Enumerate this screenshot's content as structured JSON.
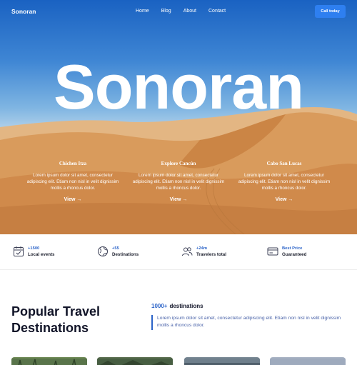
{
  "nav": {
    "brand": "Sonoran",
    "links": [
      "Home",
      "Blog",
      "About",
      "Contact"
    ],
    "cta": "Call today"
  },
  "hero": {
    "title": "Sonoran",
    "features": [
      {
        "title": "Chichen Itza",
        "desc": "Lorem ipsum dolor sit amet, consectetur adipiscing elit. Etiam non nisl in velit dignissim mollis a rhoncus dolor.",
        "link": "View →"
      },
      {
        "title": "Explore Cancún",
        "desc": "Lorem ipsum dolor sit amet, consectetur adipiscing elit. Etiam non nisl in velit dignissim mollis a rhoncus dolor.",
        "link": "View →"
      },
      {
        "title": "Cabo San Lucas",
        "desc": "Lorem ipsum dolor sit amet, consectetur adipiscing elit. Etiam non nisl in velit dignissim mollis a rhoncus dolor.",
        "link": "View →"
      }
    ]
  },
  "stats": [
    {
      "value": "+1500",
      "label": "Local events",
      "icon": "calendar-icon"
    },
    {
      "value": "+55",
      "label": "Destinations",
      "icon": "globe-icon"
    },
    {
      "value": "+24m",
      "label": "Travelers total",
      "icon": "users-icon"
    },
    {
      "value": "Best Price",
      "label": "Guaranteed",
      "icon": "ticket-icon"
    }
  ],
  "popular": {
    "title": "Popular Travel Destinations",
    "count_number": "1000+",
    "count_label": "destinations",
    "description": "Lorem ipsum dolor sit amet, consectetur adipiscing elit. Etiam non nisl in velit dignissim mollis a rhoncus dolor."
  },
  "colors": {
    "accent": "#2e7ff0",
    "stat_blue": "#2b63c8",
    "heading": "#111428"
  }
}
